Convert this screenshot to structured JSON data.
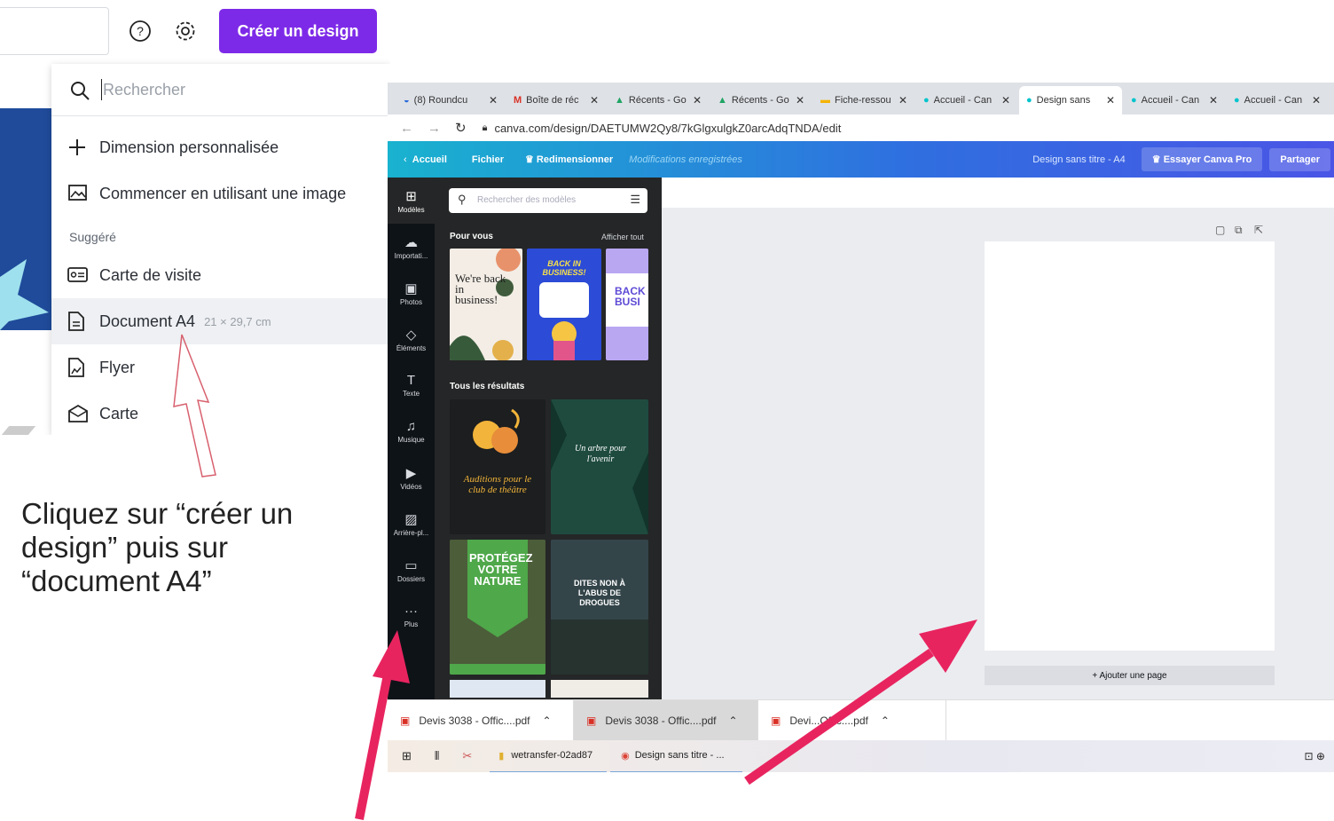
{
  "header": {
    "help_icon": "question-circle-icon",
    "settings_icon": "gear-icon",
    "create_button": "Créer un design"
  },
  "dropdown": {
    "search_placeholder": "Rechercher",
    "items": [
      {
        "label": "Dimension personnalisée",
        "icon": "plus-icon"
      },
      {
        "label": "Commencer en utilisant une image",
        "icon": "image-icon"
      }
    ],
    "section_label": "Suggéré",
    "suggested": [
      {
        "label": "Carte de visite",
        "icon": "business-card-icon",
        "dim": ""
      },
      {
        "label": "Document A4",
        "icon": "document-icon",
        "dim": "21 × 29,7 cm"
      },
      {
        "label": "Flyer",
        "icon": "flyer-icon",
        "dim": ""
      },
      {
        "label": "Carte",
        "icon": "card-icon",
        "dim": ""
      }
    ]
  },
  "instruction_text": "Cliquez sur “créer un design” puis sur “document A4”",
  "browser": {
    "tabs": [
      {
        "label": "(8) Roundcu"
      },
      {
        "label": "Boîte de réc"
      },
      {
        "label": "Récents - Go"
      },
      {
        "label": "Récents - Go"
      },
      {
        "label": "Fiche-ressou"
      },
      {
        "label": "Accueil - Can"
      },
      {
        "label": "Design sans"
      },
      {
        "label": "Accueil - Can"
      },
      {
        "label": "Accueil - Can"
      }
    ],
    "url": "canva.com/design/DAETUMW2Qy8/7kGlgxulgkZ0arcAdqTNDA/edit"
  },
  "canva_toolbar": {
    "home": "Accueil",
    "file": "Fichier",
    "resize": "Redimensionner",
    "saved": "Modifications enregistrées",
    "doc_title": "Design sans titre - A4",
    "try_pro": "Essayer Canva Pro",
    "share": "Partager"
  },
  "sidebar": [
    {
      "label": "Modèles",
      "glyph": "⊞"
    },
    {
      "label": "Importati...",
      "glyph": "☁"
    },
    {
      "label": "Photos",
      "glyph": "▣"
    },
    {
      "label": "Éléments",
      "glyph": "◇"
    },
    {
      "label": "Texte",
      "glyph": "T"
    },
    {
      "label": "Musique",
      "glyph": "♫"
    },
    {
      "label": "Vidéos",
      "glyph": "▶"
    },
    {
      "label": "Arrière-pl...",
      "glyph": "▨"
    },
    {
      "label": "Dossiers",
      "glyph": "▭"
    },
    {
      "label": "Plus",
      "glyph": "···"
    }
  ],
  "panel": {
    "search_placeholder": "Rechercher des modèles",
    "section_for_you": "Pour vous",
    "see_all": "Afficher tout",
    "section_all": "Tous les résultats",
    "templates_for_you": [
      {
        "text": "We're back in business!"
      },
      {
        "text": "BACK IN BUSINESS!"
      },
      {
        "text": "BACK BUSI"
      }
    ],
    "templates_all": [
      {
        "text": "Auditions pour le club de théâtre"
      },
      {
        "text": "Un arbre pour l'avenir"
      },
      {
        "text": "PROTÉGEZ VOTRE NATURE"
      },
      {
        "text": "DITES NON À L'ABUS DE DROGUES"
      }
    ]
  },
  "canvas": {
    "add_page": "+ Ajouter une page"
  },
  "downloads": [
    {
      "label": "Devis 3038 - Offic....pdf"
    },
    {
      "label": "Devis 3038 - Offic....pdf"
    },
    {
      "label": "Devi...Offic....pdf"
    }
  ],
  "taskbar": {
    "items": [
      {
        "label": "wetransfer-02ad87"
      },
      {
        "label": "Design sans titre - ..."
      }
    ]
  },
  "colors": {
    "accent_purple": "#7d2ae8",
    "arrow_pink": "#e8245f",
    "canva_sidebar": "#0e1318"
  }
}
